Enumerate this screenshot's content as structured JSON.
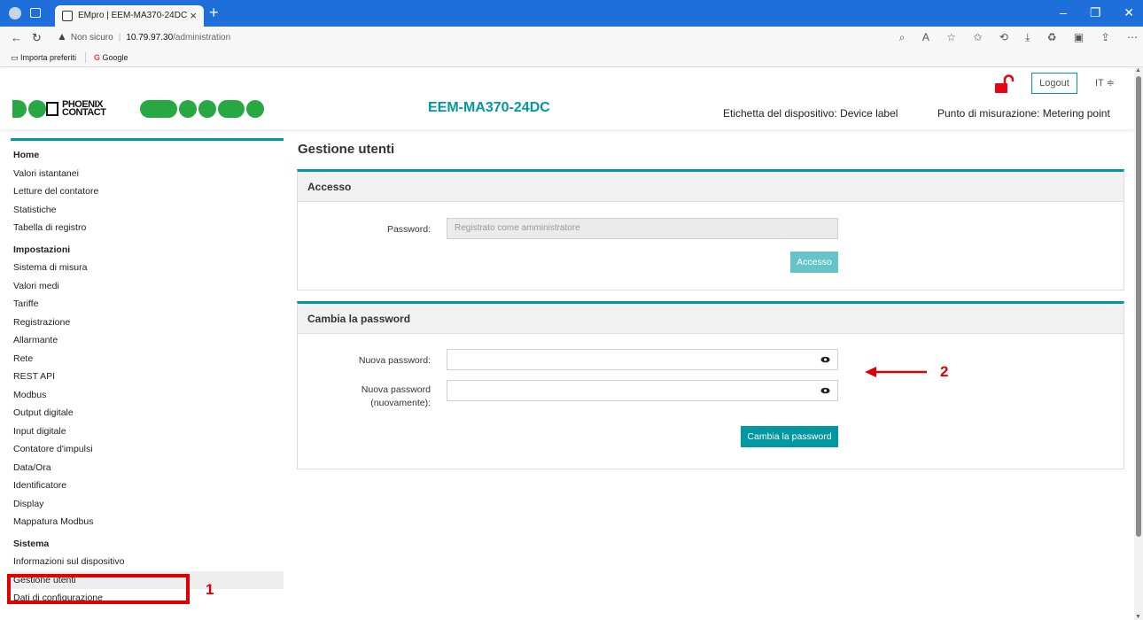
{
  "browser": {
    "tab_title": "EMpro | EEM-MA370-24DC",
    "tab_close": "×",
    "new_tab": "+",
    "url_warning": "Non sicuro",
    "url_host": "10.79.97.30",
    "url_path": "/administration",
    "favorites": [
      "Importa preferiti",
      "Google"
    ]
  },
  "header": {
    "logo_line1": "PHOENIX",
    "logo_line2": "CONTACT",
    "device_name": "EEM-MA370-24DC",
    "device_label": "Etichetta del dispositivo: Device label",
    "metering_point": "Punto di misurazione: Metering point",
    "logout": "Logout",
    "language": "IT ≑",
    "lock_color": "#e30613"
  },
  "sidebar": {
    "items": [
      {
        "label": "Home",
        "section": true
      },
      {
        "label": "Valori istantanei"
      },
      {
        "label": "Letture del contatore"
      },
      {
        "label": "Statistiche"
      },
      {
        "label": "Tabella di registro"
      },
      {
        "label": "Impostazioni",
        "section": true
      },
      {
        "label": "Sistema di misura"
      },
      {
        "label": "Valori medi"
      },
      {
        "label": "Tariffe"
      },
      {
        "label": "Registrazione"
      },
      {
        "label": "Allarmante"
      },
      {
        "label": "Rete"
      },
      {
        "label": "REST API"
      },
      {
        "label": "Modbus"
      },
      {
        "label": "Output digitale"
      },
      {
        "label": "Input digitale"
      },
      {
        "label": "Contatore d'impulsi"
      },
      {
        "label": "Data/Ora"
      },
      {
        "label": "Identificatore"
      },
      {
        "label": "Display"
      },
      {
        "label": "Mappatura Modbus"
      },
      {
        "label": "Sistema",
        "section": true
      },
      {
        "label": "Informazioni sul dispositivo"
      },
      {
        "label": "Gestione utenti",
        "active": true
      },
      {
        "label": "Dati di configurazione"
      }
    ]
  },
  "main": {
    "title": "Gestione utenti",
    "access": {
      "heading": "Accesso",
      "password_label": "Password:",
      "password_placeholder": "Registrato come amministratore",
      "button": "Accesso"
    },
    "change_password": {
      "heading": "Cambia la password",
      "new_label": "Nuova password:",
      "repeat_label_1": "Nuova password",
      "repeat_label_2": "(nuovamente):",
      "button": "Cambia la password"
    }
  },
  "annotations": {
    "marker_1": "1",
    "marker_2": "2",
    "color": "#e00000"
  },
  "theme": {
    "accent": "#0098a1",
    "logo_green": "#27a843"
  }
}
